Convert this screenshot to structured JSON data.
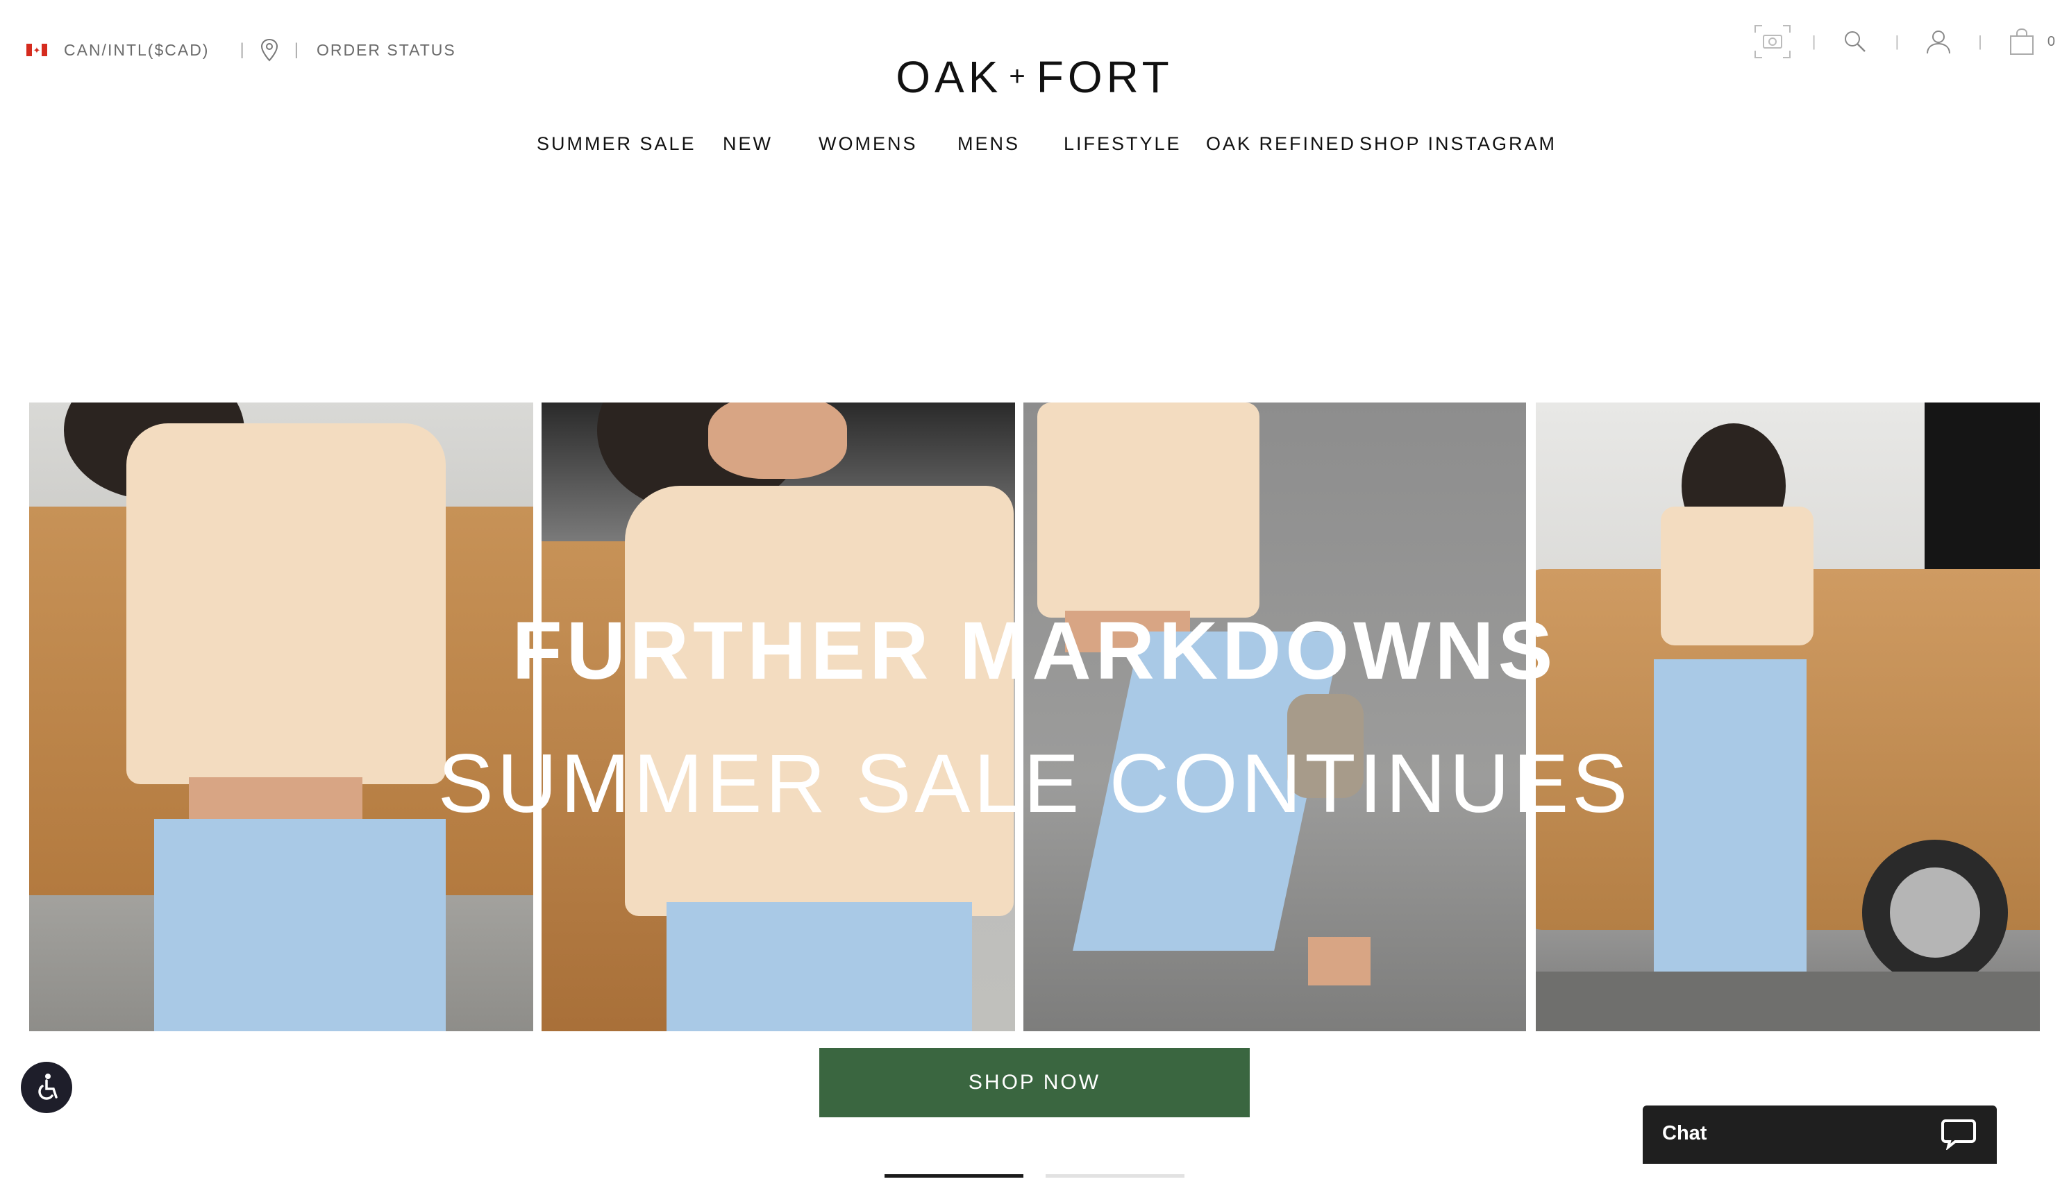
{
  "locale": {
    "flag_icon": "canada-flag-icon",
    "label": "CAN/INTL($CAD)"
  },
  "util": {
    "order_status": "ORDER STATUS",
    "separator": "|"
  },
  "header_icons": [
    "camera-icon",
    "search-icon",
    "account-icon",
    "cart-icon"
  ],
  "cart": {
    "count": "0"
  },
  "logo": {
    "left": "OAK",
    "plus": "+",
    "right": "FORT"
  },
  "nav": {
    "items": [
      {
        "label": "SUMMER SALE"
      },
      {
        "label": "NEW"
      },
      {
        "label": "WOMENS"
      },
      {
        "label": "MENS"
      },
      {
        "label": "LIFESTYLE"
      },
      {
        "label": "OAK REFINED"
      },
      {
        "label": "SHOP INSTAGRAM"
      }
    ]
  },
  "hero": {
    "headline": "FURTHER MARKDOWNS",
    "subline": "SUMMER SALE CONTINUES",
    "cta": "SHOP NOW",
    "slides_total": 2,
    "active_slide": 1
  },
  "chat": {
    "label": "Chat"
  },
  "colors": {
    "cta": "#3a6640",
    "chat": "#1f1f1f",
    "a11y": "#1e1e2a",
    "accent_red": "#d52b1e"
  }
}
